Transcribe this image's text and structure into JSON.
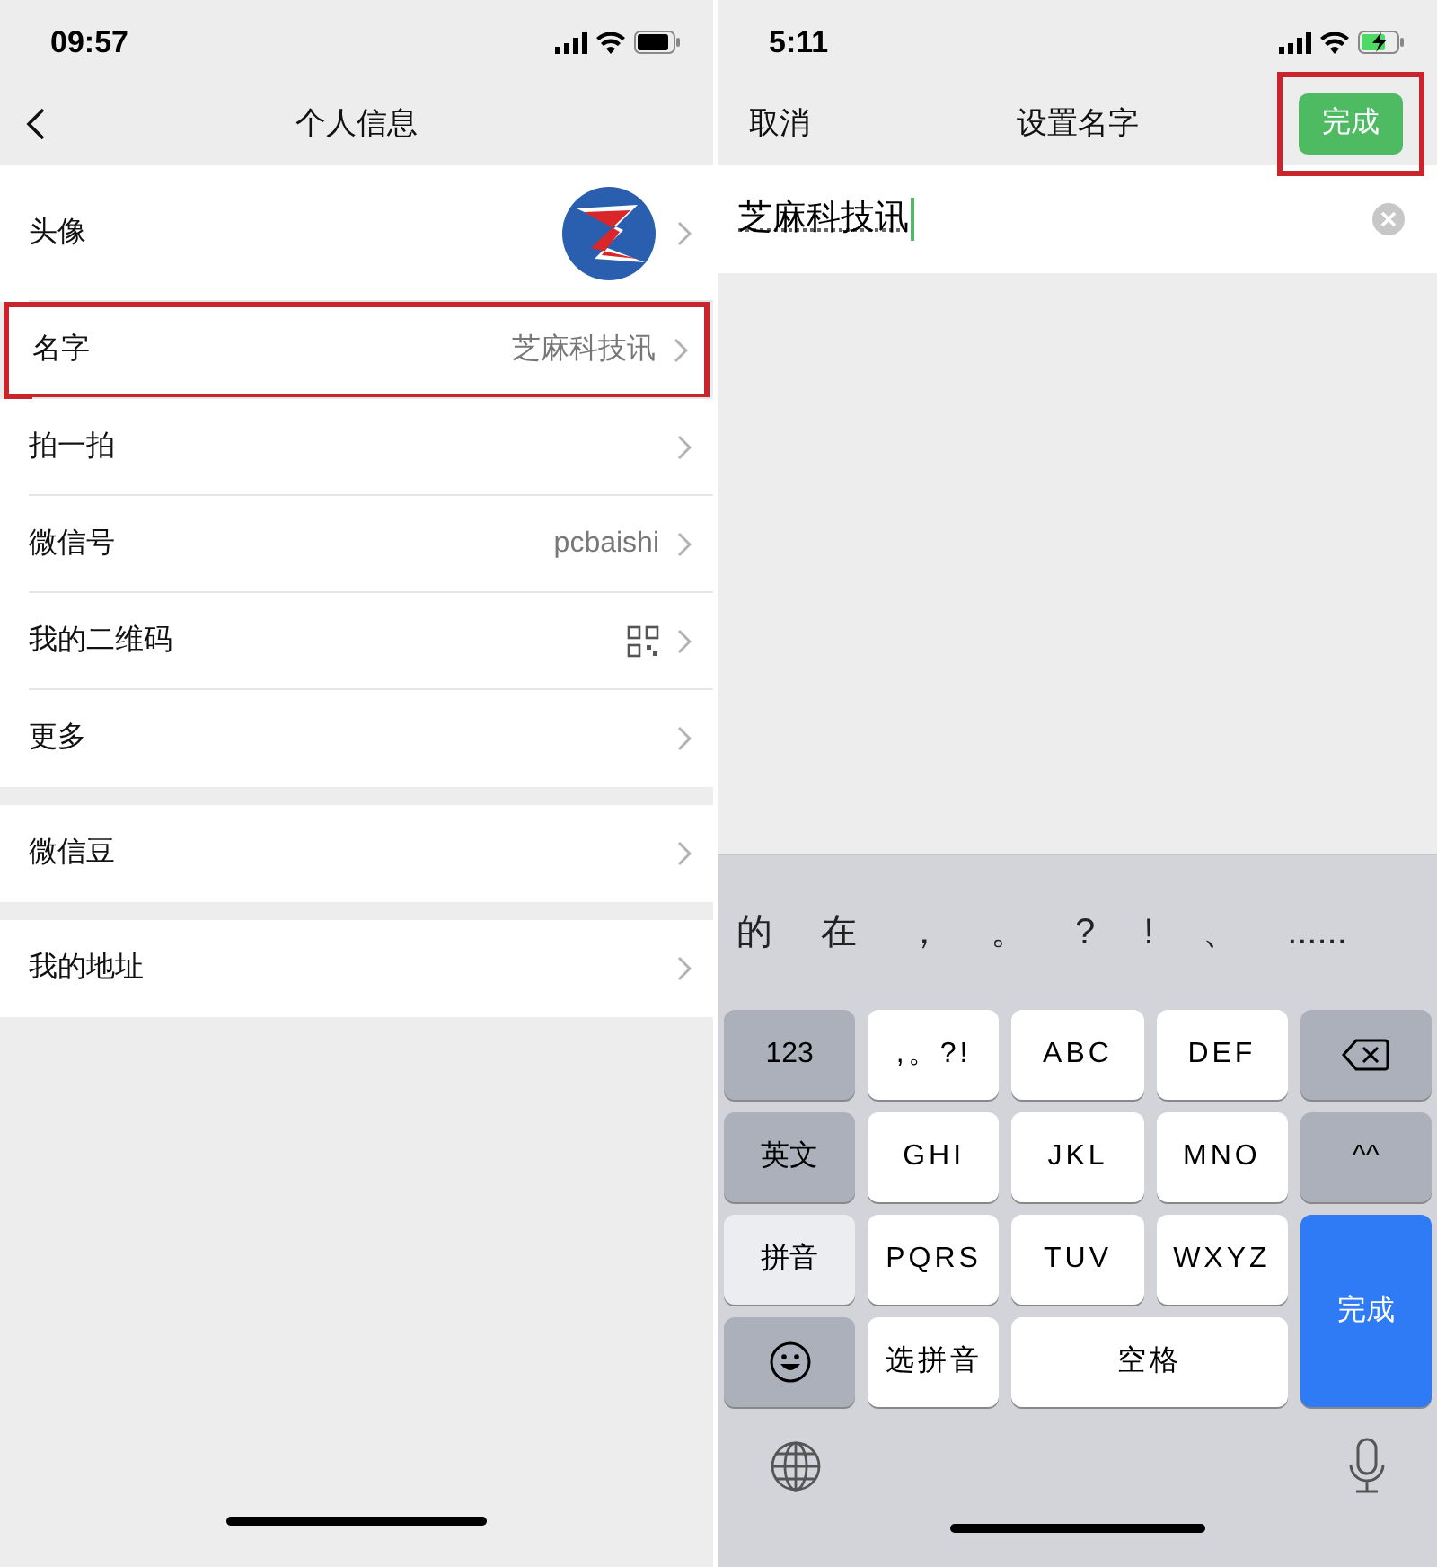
{
  "left": {
    "status": {
      "time": "09:57",
      "charging": false
    },
    "nav": {
      "title": "个人信息"
    },
    "groups": [
      [
        {
          "label": "头像",
          "kind": "avatar",
          "highlighted": false
        },
        {
          "label": "名字",
          "kind": "text",
          "value": "芝麻科技讯",
          "highlighted": true
        },
        {
          "label": "拍一拍",
          "kind": "plain",
          "highlighted": false
        },
        {
          "label": "微信号",
          "kind": "text",
          "value": "pcbaishi",
          "highlighted": false
        },
        {
          "label": "我的二维码",
          "kind": "qrcode",
          "highlighted": false
        },
        {
          "label": "更多",
          "kind": "plain",
          "highlighted": false
        }
      ],
      [
        {
          "label": "微信豆",
          "kind": "plain",
          "highlighted": false
        }
      ],
      [
        {
          "label": "我的地址",
          "kind": "plain",
          "highlighted": false
        }
      ]
    ]
  },
  "right": {
    "status": {
      "time": "5:11",
      "charging": true
    },
    "nav": {
      "cancel": "取消",
      "title": "设置名字",
      "done": {
        "label": "完成",
        "highlighted": true
      }
    },
    "field": {
      "value": "芝麻科技讯",
      "composing": true
    },
    "candidates": [
      "的",
      "在",
      "，",
      "。",
      "?",
      "!",
      "、",
      "......"
    ],
    "keys": [
      {
        "label": "123",
        "kind": "function"
      },
      {
        "label": ",。?!",
        "kind": "letter"
      },
      {
        "label": "ABC",
        "kind": "letter"
      },
      {
        "label": "DEF",
        "kind": "letter"
      },
      {
        "kind": "delete"
      },
      {
        "label": "英文",
        "kind": "function"
      },
      {
        "label": "GHI",
        "kind": "letter"
      },
      {
        "label": "JKL",
        "kind": "letter"
      },
      {
        "label": "MNO",
        "kind": "letter"
      },
      {
        "label": "^^",
        "kind": "function"
      },
      {
        "label": "拼音",
        "kind": "selected"
      },
      {
        "label": "PQRS",
        "kind": "letter"
      },
      {
        "label": "TUV",
        "kind": "letter"
      },
      {
        "label": "WXYZ",
        "kind": "letter"
      },
      {
        "label": "完成",
        "kind": "enter"
      },
      {
        "kind": "emoji"
      },
      {
        "label": "选拼音",
        "kind": "letter"
      },
      {
        "label": "空格",
        "kind": "space"
      }
    ]
  }
}
